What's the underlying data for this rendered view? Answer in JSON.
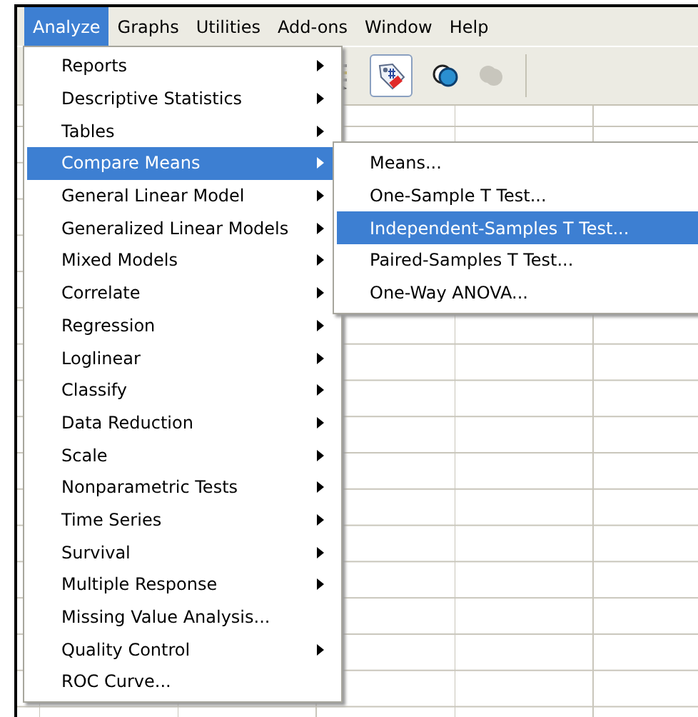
{
  "menubar": [
    {
      "label": "Analyze",
      "selected": true
    },
    {
      "label": "Graphs",
      "selected": false
    },
    {
      "label": "Utilities",
      "selected": false
    },
    {
      "label": "Add-ons",
      "selected": false
    },
    {
      "label": "Window",
      "selected": false
    },
    {
      "label": "Help",
      "selected": false
    }
  ],
  "menu": {
    "items": [
      {
        "label": "Reports",
        "kind": "submenu",
        "selected": false
      },
      {
        "label": "Descriptive Statistics",
        "kind": "submenu",
        "selected": false
      },
      {
        "label": "Tables",
        "kind": "submenu",
        "selected": false
      },
      {
        "label": "Compare Means",
        "kind": "submenu",
        "selected": true
      },
      {
        "label": "General Linear Model",
        "kind": "submenu",
        "selected": false
      },
      {
        "label": "Generalized Linear Models",
        "kind": "submenu",
        "selected": false
      },
      {
        "label": "Mixed Models",
        "kind": "submenu",
        "selected": false
      },
      {
        "label": "Correlate",
        "kind": "submenu",
        "selected": false
      },
      {
        "label": "Regression",
        "kind": "submenu",
        "selected": false
      },
      {
        "label": "Loglinear",
        "kind": "submenu",
        "selected": false
      },
      {
        "label": "Classify",
        "kind": "submenu",
        "selected": false
      },
      {
        "label": "Data Reduction",
        "kind": "submenu",
        "selected": false
      },
      {
        "label": "Scale",
        "kind": "submenu",
        "selected": false
      },
      {
        "label": "Nonparametric Tests",
        "kind": "submenu",
        "selected": false
      },
      {
        "label": "Time Series",
        "kind": "submenu",
        "selected": false
      },
      {
        "label": "Survival",
        "kind": "submenu",
        "selected": false
      },
      {
        "label": "Multiple Response",
        "kind": "submenu",
        "selected": false
      },
      {
        "label": "Missing Value Analysis...",
        "kind": "command",
        "selected": false
      },
      {
        "label": "Quality Control",
        "kind": "submenu",
        "selected": false
      },
      {
        "label": "ROC Curve...",
        "kind": "command",
        "selected": false
      }
    ]
  },
  "submenu": {
    "items": [
      {
        "label": "Means...",
        "selected": false
      },
      {
        "label": "One-Sample T Test...",
        "selected": false
      },
      {
        "label": "Independent-Samples T Test...",
        "selected": true
      },
      {
        "label": "Paired-Samples T Test...",
        "selected": false
      },
      {
        "label": "One-Way ANOVA...",
        "selected": false
      }
    ]
  }
}
